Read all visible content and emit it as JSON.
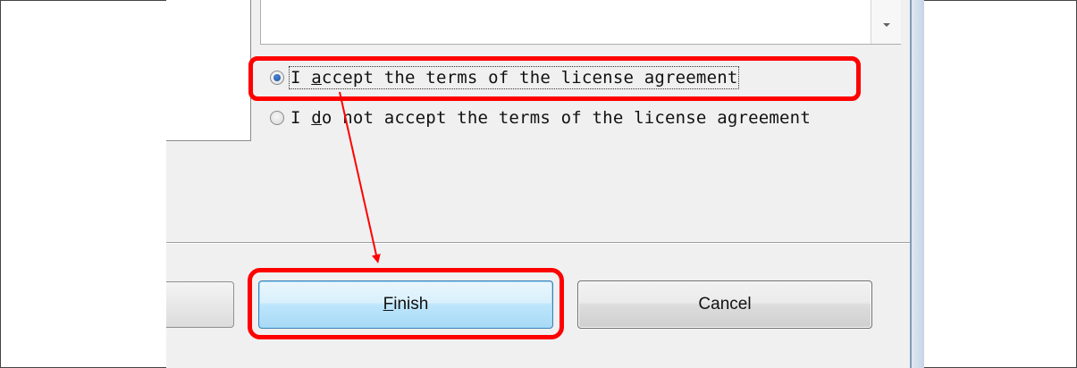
{
  "license": {
    "accept_label_pre": "I ",
    "accept_label_accel": "a",
    "accept_label_post": "ccept the terms of the license agreement",
    "decline_label_pre": "I ",
    "decline_label_accel": "d",
    "decline_label_post": "o not accept the terms of the license agreement",
    "selected": "accept"
  },
  "buttons": {
    "finish_accel": "F",
    "finish_rest": "inish",
    "cancel_label": "Cancel"
  },
  "annotation": {
    "color": "#ff0000"
  }
}
